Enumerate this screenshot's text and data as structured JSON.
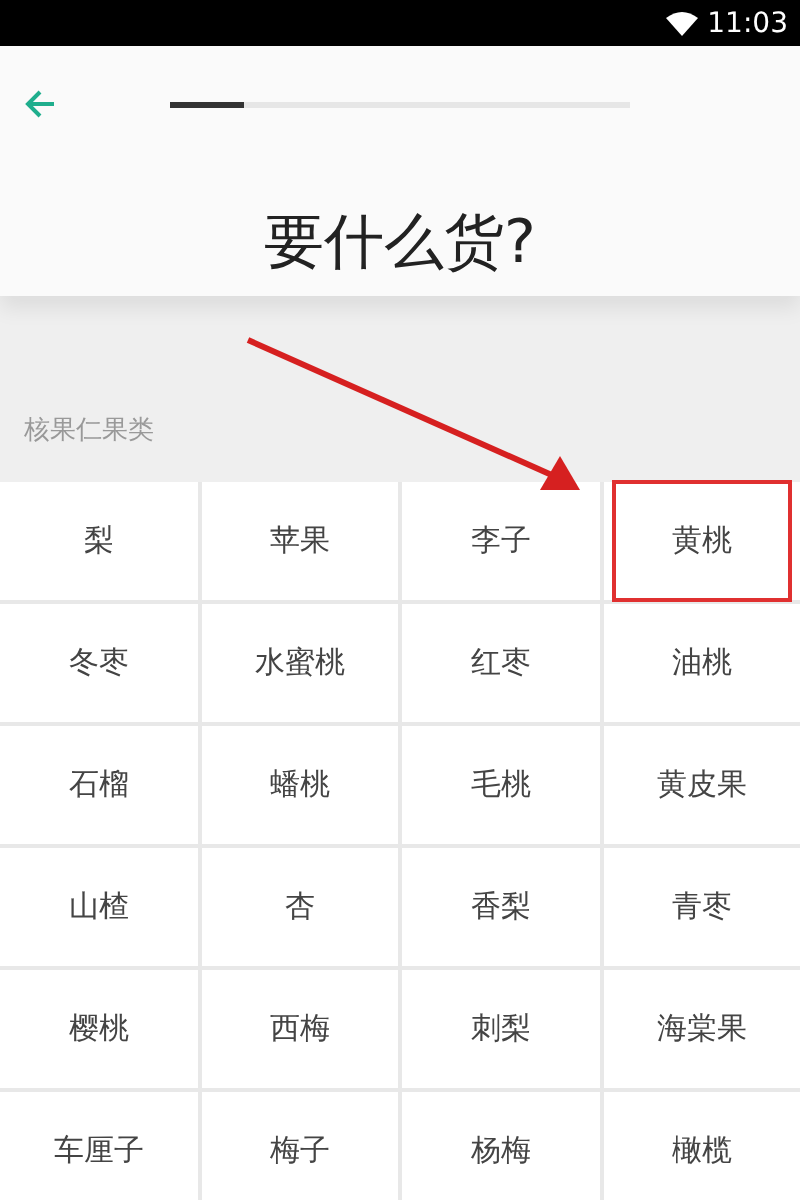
{
  "status_bar": {
    "time": "11:03"
  },
  "header": {
    "progress": {
      "level": 0.16
    },
    "title": "要什么货?"
  },
  "category": {
    "label": "核果仁果类",
    "items": [
      {
        "label": "梨",
        "highlighted": false
      },
      {
        "label": "苹果",
        "highlighted": false
      },
      {
        "label": "李子",
        "highlighted": false
      },
      {
        "label": "黄桃",
        "highlighted": true
      },
      {
        "label": "冬枣",
        "highlighted": false
      },
      {
        "label": "水蜜桃",
        "highlighted": false
      },
      {
        "label": "红枣",
        "highlighted": false
      },
      {
        "label": "油桃",
        "highlighted": false
      },
      {
        "label": "石榴",
        "highlighted": false
      },
      {
        "label": "蟠桃",
        "highlighted": false
      },
      {
        "label": "毛桃",
        "highlighted": false
      },
      {
        "label": "黄皮果",
        "highlighted": false
      },
      {
        "label": "山楂",
        "highlighted": false
      },
      {
        "label": "杏",
        "highlighted": false
      },
      {
        "label": "香梨",
        "highlighted": false
      },
      {
        "label": "青枣",
        "highlighted": false
      },
      {
        "label": "樱桃",
        "highlighted": false
      },
      {
        "label": "西梅",
        "highlighted": false
      },
      {
        "label": "刺梨",
        "highlighted": false
      },
      {
        "label": "海棠果",
        "highlighted": false
      },
      {
        "label": "车厘子",
        "highlighted": false
      },
      {
        "label": "梅子",
        "highlighted": false
      },
      {
        "label": "杨梅",
        "highlighted": false
      },
      {
        "label": "橄榄",
        "highlighted": false
      }
    ]
  }
}
